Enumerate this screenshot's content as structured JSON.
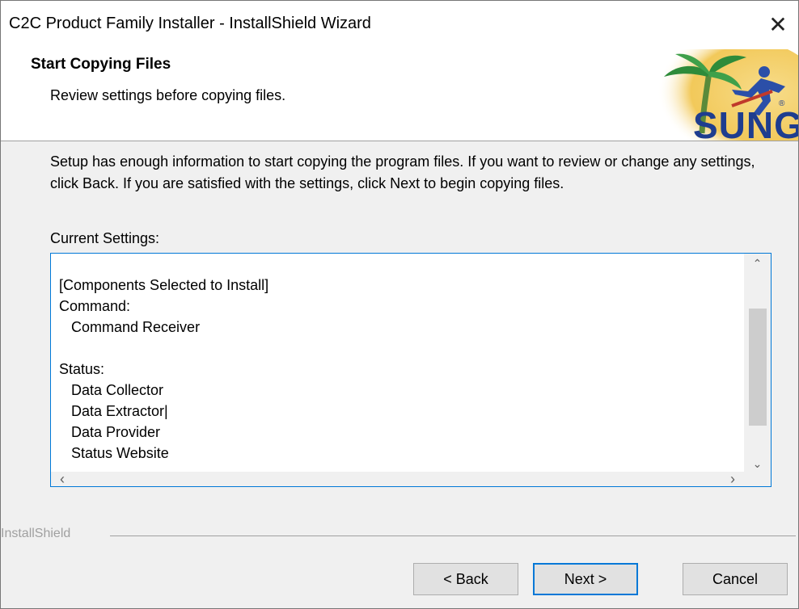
{
  "window": {
    "title": "C2C Product Family Installer - InstallShield Wizard",
    "close_glyph": "✕"
  },
  "header": {
    "title": "Start Copying Files",
    "subtitle": "Review settings before copying files.",
    "logo_text": "SUNGUIDE",
    "logo_mark": "®"
  },
  "body": {
    "intro": "Setup has enough information to start copying the program files.  If you want to review or change any settings, click Back.  If you are satisfied with the settings, click Next to begin copying files.",
    "current_settings_label": "Current Settings:",
    "settings_text": "[Components Selected to Install]\nCommand:\n   Command Receiver\n\nStatus:\n   Data Collector\n   Data Extractor|\n   Data Provider\n   Status Website"
  },
  "scrollbars": {
    "up_glyph": "⌃",
    "down_glyph": "⌄",
    "left_glyph": "‹",
    "right_glyph": "›"
  },
  "footer": {
    "brand": "InstallShield",
    "back_label": "< Back",
    "next_label": "Next >",
    "cancel_label": "Cancel"
  },
  "colors": {
    "accent": "#0078d7",
    "dialog_bg": "#f0f0f0",
    "logo_sun": "#f2c95a",
    "logo_palm": "#2e8b3a",
    "logo_figure": "#2b4fa8",
    "logo_text": "#1e3d8f"
  },
  "icons": {
    "close": "close-icon",
    "logo": "sunguide-logo"
  }
}
